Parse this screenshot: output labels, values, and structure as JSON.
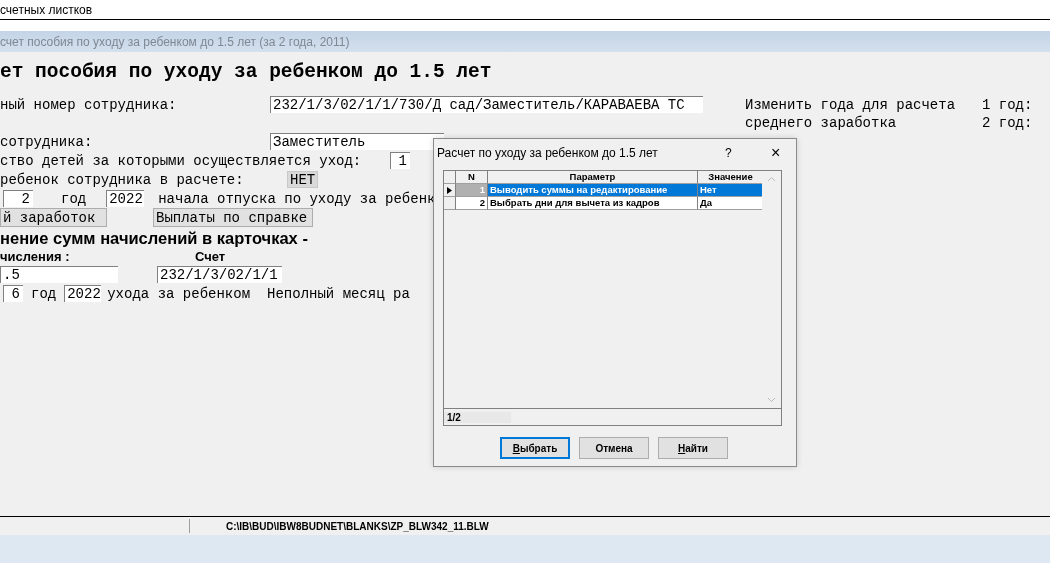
{
  "top_strip": {
    "text": "счетных листков"
  },
  "window": {
    "title": "счет пособия по уходу за ребенком до 1.5 лет (за 2 года, 2011)"
  },
  "form": {
    "heading": "ет пособия по уходу за ребенком до 1.5 лет",
    "employee_label": "ный номер сотрудника:",
    "employee_value": "232/1/3/02/1/1/730/Д сад/Заместитель/КАРАВАЕВА ТС",
    "years_note": [
      "Изменить года для расчета",
      "среднего заработка"
    ],
    "year_labels": [
      "1 год:",
      "2 год:"
    ],
    "position_label": "сотрудника:",
    "position_value": "Заместитель",
    "children_label": "ство детей за которыми осуществляется уход:",
    "children_value": "1",
    "child_label": "ребенок сотрудника в расчете:",
    "child_value": "НЕТ",
    "leave_start": {
      "month": "2",
      "year_label": "год",
      "year": "2022",
      "text": "начала отпуска по уходу за ребенк"
    },
    "buttons": [
      "й заработок",
      "Выплаты по справке"
    ],
    "section_title": "нение сумм начислений в карточках -",
    "col_labels": [
      "числения :",
      "Счет"
    ],
    "accrual_value": ".5",
    "account_value": "232/1/3/02/1/1",
    "leave_end": {
      "month": "6",
      "year_label": "год",
      "year": "2022",
      "text": "ухода за ребенком",
      "note": "Неполный месяц ра"
    }
  },
  "dialog": {
    "title": "Расчет по уходу за ребенком до 1.5 лет",
    "help": "?",
    "close": "×",
    "columns": [
      "N",
      "Параметр",
      "Значение"
    ],
    "rows": [
      {
        "n": "1",
        "param": "Выводить суммы на редактирование",
        "value": "Нет",
        "selected": true
      },
      {
        "n": "2",
        "param": "Выбрать дни для вычета из кадров",
        "value": "Да",
        "selected": false
      }
    ],
    "counter": "1/2",
    "buttons": [
      {
        "label": "Выбрать",
        "default": true,
        "mnemonic": true
      },
      {
        "label": "Отмена",
        "default": false,
        "mnemonic": false
      },
      {
        "label": "Найти",
        "default": false,
        "mnemonic": true
      }
    ]
  },
  "status_bar": {
    "path": "C:\\IB\\BUD\\IBW8BUDNET\\BLANKS\\ZP_BLW342_11.BLW"
  }
}
